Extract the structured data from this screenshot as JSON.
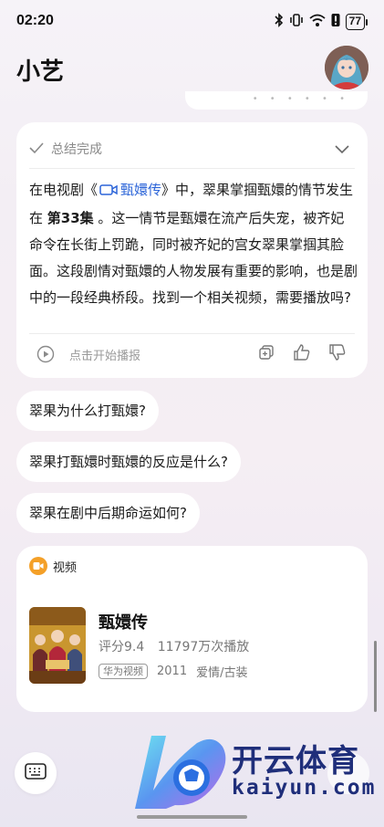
{
  "status_bar": {
    "time": "02:20",
    "battery": "77"
  },
  "header": {
    "title": "小艺"
  },
  "answer": {
    "summary_label": "总结完成",
    "text_before_link": "在电视剧《",
    "link_text": "甄嬛传",
    "text_after_link": "》中，翠果掌掴甄嬛的情节发生在 ",
    "episode": "第33集",
    "text_rest": " 。这一情节是甄嬛在流产后失宠，被齐妃命令在长街上罚跪，同时被齐妃的宫女翠果掌掴其脸面。这段剧情对甄嬛的人物发展有重要的影响，也是剧中的一段经典桥段。找到一个相关视频，需要播放吗?",
    "play_label": "点击开始播报"
  },
  "suggestions": [
    "翠果为什么打甄嬛?",
    "翠果打甄嬛时甄嬛的反应是什么?",
    "翠果在剧中后期命运如何?"
  ],
  "video_card": {
    "section_label": "视频",
    "title": "甄嬛传",
    "rating": "评分9.4",
    "plays": "11797万次播放",
    "source_badge": "华为视频",
    "year": "2011",
    "genre": "爱情/古装"
  },
  "watermark": {
    "cn": "开云体育",
    "en": "kaiyun.com"
  },
  "colors": {
    "link": "#2b64d8",
    "video_icon": "#f4a028",
    "watermark": "#1f2e7a"
  },
  "icons": {
    "bluetooth": "bluetooth-icon",
    "vibrate": "vibrate-icon",
    "wifi": "wifi-icon",
    "alert": "alert-icon",
    "check": "check-icon",
    "chevron": "chevron-down-icon",
    "play": "play-icon",
    "copy": "copy-icon",
    "like": "thumbs-up-icon",
    "dislike": "thumbs-down-icon",
    "keyboard": "keyboard-icon",
    "video": "video-icon"
  }
}
